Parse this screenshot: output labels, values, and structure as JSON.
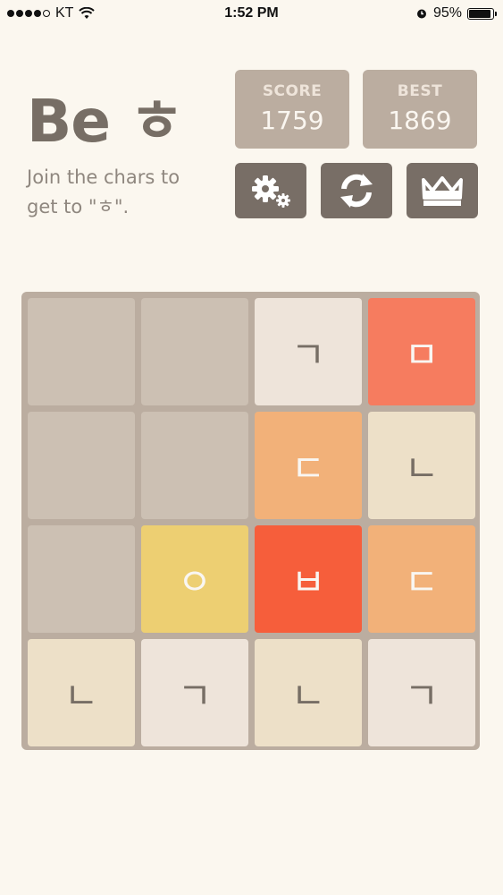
{
  "status": {
    "carrier": "KT",
    "time": "1:52 PM",
    "battery": "95%"
  },
  "header": {
    "title": "Be ㅎ",
    "subtitle_line1": "Join the chars to",
    "subtitle_line2": "get to \"ㅎ\"."
  },
  "score": {
    "label": "SCORE",
    "value": "1759"
  },
  "best": {
    "label": "BEST",
    "value": "1869"
  },
  "buttons": [
    "gear-icon",
    "refresh-icon",
    "crown-icon"
  ],
  "board": {
    "rows": [
      [
        "",
        "",
        "ㄱ",
        "ㅁ"
      ],
      [
        "",
        "",
        "ㄷ",
        "ㄴ"
      ],
      [
        "",
        "ㅇ",
        "ㅂ",
        "ㄷ"
      ],
      [
        "ㄴ",
        "ㄱ",
        "ㄴ",
        "ㄱ"
      ]
    ]
  },
  "colors": {
    "ㄱ": "#eee4da",
    "ㄴ": "#ede0c8",
    "ㄷ": "#f2b179",
    "ㅁ": "#f67c5f",
    "ㅂ": "#f65e3b",
    "ㅇ": "#edcf72",
    "empty": "#ccc0b3"
  }
}
